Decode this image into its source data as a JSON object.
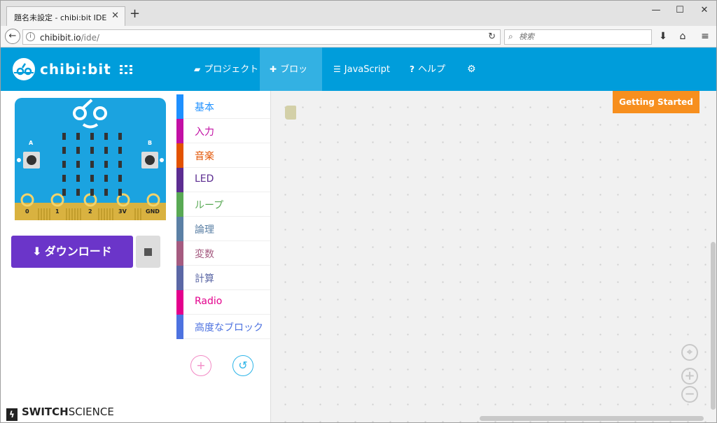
{
  "browser": {
    "tab_title": "題名未設定 - chibi:bit IDE",
    "tab_close": "✕",
    "new_tab": "+",
    "minimize": "—",
    "maximize": "☐",
    "close": "✕",
    "url_host": "chibibit.io",
    "url_path": "/ide/",
    "search_placeholder": "検索"
  },
  "header": {
    "logo_text": "chibi:bit",
    "nav": [
      {
        "label": "プロジェクト",
        "icon": "folder-open-icon",
        "active": false
      },
      {
        "label": "ブロック",
        "icon": "puzzle-icon",
        "active": true
      },
      {
        "label": "JavaScript",
        "icon": "code-align-icon",
        "active": false
      },
      {
        "label": "ヘルプ",
        "icon": "question-icon",
        "active": false
      },
      {
        "label": "",
        "icon": "gear-icon",
        "active": false
      }
    ],
    "bg_color": "#009ddb"
  },
  "simulator": {
    "button_a": "A",
    "button_b": "B",
    "pins": [
      "0",
      "1",
      "2",
      "3V",
      "GND"
    ],
    "board_color": "#1ba3e0",
    "edge_color": "#d9b240"
  },
  "download_button": {
    "label": "ダウンロード",
    "color": "#6b35c9"
  },
  "toolbox": {
    "categories": [
      {
        "label": "基本",
        "color": "#1e90ff"
      },
      {
        "label": "入力",
        "color": "#c20fa4"
      },
      {
        "label": "音楽",
        "color": "#e25200"
      },
      {
        "label": "LED",
        "color": "#5c2d91"
      },
      {
        "label": "ループ",
        "color": "#59a954"
      },
      {
        "label": "論理",
        "color": "#5b80a5"
      },
      {
        "label": "変数",
        "color": "#a55b80"
      },
      {
        "label": "計算",
        "color": "#5b67a5"
      },
      {
        "label": "Radio",
        "color": "#e3008c"
      },
      {
        "label": "高度なブロック",
        "color": "#4d72e0"
      }
    ],
    "add_button": "+",
    "undo_button": "↺"
  },
  "workspace": {
    "getting_started": "Getting Started",
    "zoom_in": "+",
    "zoom_out": "−"
  },
  "footer": {
    "brand_bold": "SWITCH",
    "brand_light": "SCIENCE"
  }
}
